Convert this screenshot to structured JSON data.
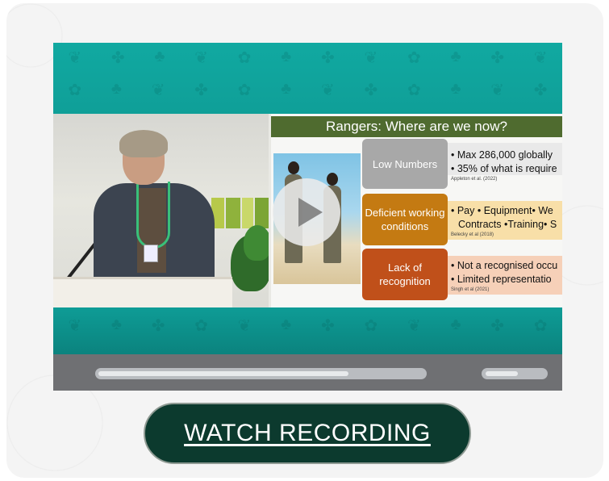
{
  "video": {
    "slide": {
      "title": "Rangers: Where are we now?",
      "rows": [
        {
          "label": "Low Numbers",
          "label_color": "#a8a8a8",
          "bullets": [
            "• Max 286,000 globally",
            "• 35% of what is require"
          ],
          "citation": "Appleton et al. (2022)"
        },
        {
          "label": "Deficient working conditions",
          "label_color": "#c47a12",
          "bullets": [
            "• Pay • Equipment• We",
            "Contracts •Training• S"
          ],
          "citation": "Belecky et al (2018)"
        },
        {
          "label": "Lack of recognition",
          "label_color": "#c0501a",
          "bullets": [
            "• Not a recognised occu",
            "• Limited representatio"
          ],
          "citation": "Singh et al (2021)"
        }
      ]
    },
    "progress_fraction": 0.77,
    "volume_fraction": 0.55
  },
  "cta": {
    "label": "WATCH RECORDING",
    "color": "#0c3a2e"
  }
}
